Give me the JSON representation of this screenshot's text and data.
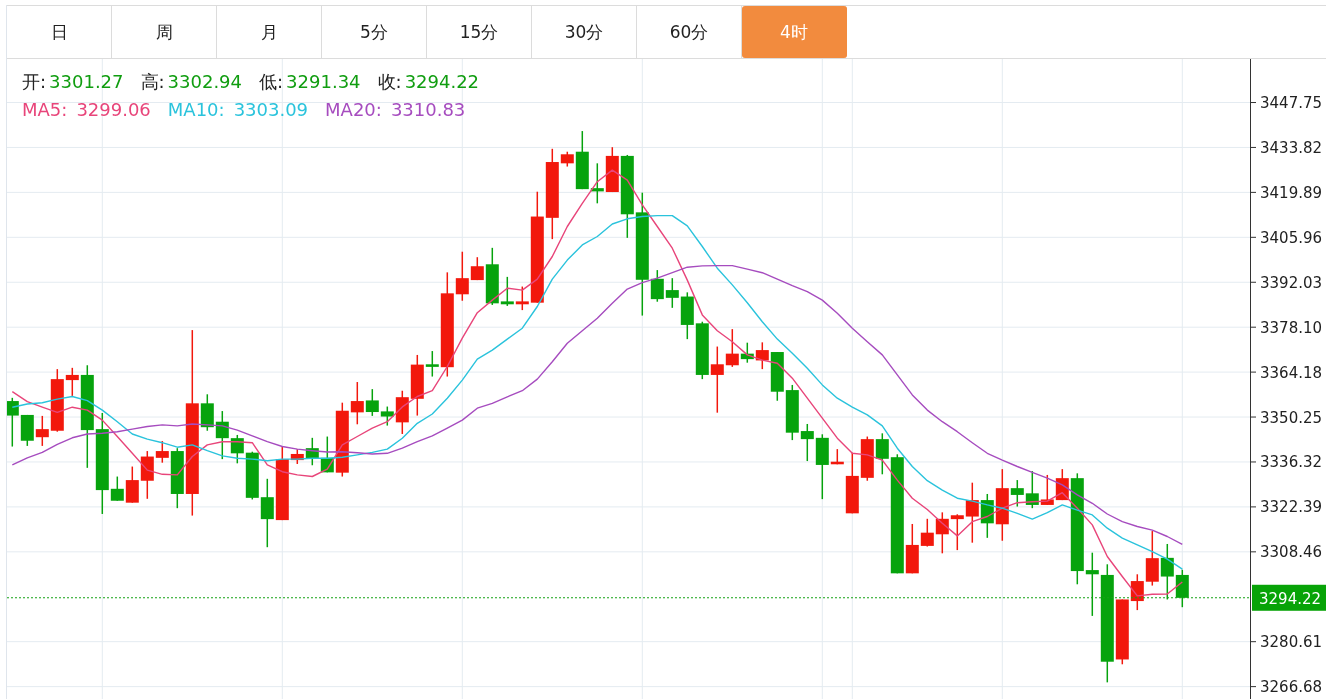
{
  "timeframe_tabs": [
    {
      "label": "日",
      "selected": false
    },
    {
      "label": "周",
      "selected": false
    },
    {
      "label": "月",
      "selected": false
    },
    {
      "label": "5分",
      "selected": false
    },
    {
      "label": "15分",
      "selected": false
    },
    {
      "label": "30分",
      "selected": false
    },
    {
      "label": "60分",
      "selected": false
    },
    {
      "label": "4时",
      "selected": true
    }
  ],
  "quote": {
    "prices": [
      {
        "label": "开:",
        "value": "3301.27"
      },
      {
        "label": "高:",
        "value": "3302.94"
      },
      {
        "label": "低:",
        "value": "3291.34"
      },
      {
        "label": "收:",
        "value": "3294.22"
      }
    ],
    "averages": [
      {
        "label": "MA5:",
        "value": "3299.06",
        "color": "#e8457a"
      },
      {
        "label": "MA10:",
        "value": "3303.09",
        "color": "#2ac3dc"
      },
      {
        "label": "MA20:",
        "value": "3310.83",
        "color": "#a64cbf"
      }
    ]
  },
  "chart": {
    "chart_data": {
      "type": "candlestick",
      "grid": true,
      "ylim": [
        3262.84,
        3461.24
      ],
      "yticks": [
        3447.75,
        3433.82,
        3419.89,
        3405.96,
        3392.03,
        {
          "value": 3378.1,
          "label": "3378.10"
        },
        3364.18,
        3350.25,
        3336.32,
        3322.39,
        3308.46,
        3280.61,
        3266.68
      ],
      "ohlc": [
        [
          3355.2,
          3356.2,
          3341.1,
          3350.7
        ],
        [
          3350.9,
          3350.9,
          3341.3,
          3342.9
        ],
        [
          3344.0,
          3350.6,
          3341.3,
          3346.5
        ],
        [
          3346.0,
          3365.1,
          3345.7,
          3362.0
        ],
        [
          3361.7,
          3365.5,
          3356.8,
          3363.3
        ],
        [
          3363.3,
          3366.3,
          3334.5,
          3346.2
        ],
        [
          3346.5,
          3351.5,
          3320.2,
          3327.6
        ],
        [
          3328.0,
          3331.8,
          3324.3,
          3324.3
        ],
        [
          3323.7,
          3334.9,
          3323.7,
          3330.7
        ],
        [
          3330.5,
          3339.7,
          3324.9,
          3338.0
        ],
        [
          3337.6,
          3342.8,
          3336.1,
          3339.7
        ],
        [
          3339.7,
          3340.6,
          3322.0,
          3326.4
        ],
        [
          3326.4,
          3377.2,
          3319.7,
          3354.5
        ],
        [
          3354.5,
          3357.3,
          3346.0,
          3347.1
        ],
        [
          3348.8,
          3352.1,
          3337.2,
          3343.7
        ],
        [
          3343.7,
          3344.7,
          3335.9,
          3339.0
        ],
        [
          3339.2,
          3339.5,
          3324.7,
          3325.2
        ],
        [
          3325.4,
          3331.1,
          3309.9,
          3318.6
        ],
        [
          3318.3,
          3341.1,
          3318.3,
          3337.2
        ],
        [
          3336.9,
          3340.3,
          3335.7,
          3338.8
        ],
        [
          3340.6,
          3343.8,
          3335.3,
          3337.5
        ],
        [
          3337.6,
          3344.2,
          3333.1,
          3333.1
        ],
        [
          3333.0,
          3354.7,
          3331.8,
          3352.2
        ],
        [
          3351.7,
          3361.1,
          3348.0,
          3355.2
        ],
        [
          3355.4,
          3358.9,
          3350.6,
          3351.8
        ],
        [
          3352.0,
          3353.5,
          3347.6,
          3350.4
        ],
        [
          3348.6,
          3358.4,
          3345.0,
          3356.4
        ],
        [
          3355.9,
          3369.5,
          3350.7,
          3366.5
        ],
        [
          3366.6,
          3370.7,
          3362.8,
          3365.8
        ],
        [
          3365.7,
          3395.1,
          3362.8,
          3388.6
        ],
        [
          3388.3,
          3401.5,
          3386.3,
          3393.3
        ],
        [
          3392.7,
          3399.8,
          3392.7,
          3397.0
        ],
        [
          3397.6,
          3402.7,
          3385.0,
          3385.5
        ],
        [
          3386.1,
          3393.7,
          3384.7,
          3385.2
        ],
        [
          3385.2,
          3390.7,
          3383.4,
          3386.1
        ],
        [
          3385.7,
          3420.1,
          3385.7,
          3412.4
        ],
        [
          3412.0,
          3433.4,
          3405.4,
          3429.3
        ],
        [
          3428.9,
          3432.5,
          3427.9,
          3431.7
        ],
        [
          3432.5,
          3438.9,
          3420.9,
          3420.9
        ],
        [
          3421.2,
          3428.9,
          3416.5,
          3420.2
        ],
        [
          3420.0,
          3433.9,
          3420.0,
          3431.2
        ],
        [
          3431.2,
          3431.5,
          3405.8,
          3413.1
        ],
        [
          3413.7,
          3419.8,
          3381.7,
          3392.8
        ],
        [
          3393.1,
          3395.8,
          3386.0,
          3386.8
        ],
        [
          3389.6,
          3393.3,
          3384.1,
          3387.2
        ],
        [
          3387.6,
          3388.9,
          3374.4,
          3378.8
        ],
        [
          3379.3,
          3379.8,
          3362.0,
          3363.3
        ],
        [
          3363.3,
          3372.1,
          3351.6,
          3366.6
        ],
        [
          3366.3,
          3377.5,
          3365.8,
          3369.9
        ],
        [
          3369.9,
          3373.3,
          3367.1,
          3368.2
        ],
        [
          3367.8,
          3373.4,
          3365.1,
          3371.0
        ],
        [
          3370.4,
          3370.4,
          3355.3,
          3358.1
        ],
        [
          3358.6,
          3360.2,
          3343.1,
          3345.4
        ],
        [
          3345.9,
          3348.1,
          3336.6,
          3343.4
        ],
        [
          3343.8,
          3344.9,
          3324.8,
          3335.4
        ],
        [
          3335.6,
          3340.3,
          3335.6,
          3336.4
        ],
        [
          3320.4,
          3339.2,
          3320.4,
          3332.0
        ],
        [
          3331.4,
          3344.2,
          3330.5,
          3343.4
        ],
        [
          3343.4,
          3345.2,
          3332.5,
          3337.3
        ],
        [
          3337.8,
          3338.7,
          3301.8,
          3301.8
        ],
        [
          3301.8,
          3317.1,
          3301.8,
          3310.6
        ],
        [
          3310.3,
          3318.7,
          3310.1,
          3314.4
        ],
        [
          3313.9,
          3320.7,
          3308.0,
          3318.7
        ],
        [
          3318.6,
          3320.1,
          3309.0,
          3319.8
        ],
        [
          3319.4,
          3329.9,
          3311.3,
          3324.5
        ],
        [
          3324.5,
          3326.4,
          3312.8,
          3317.3
        ],
        [
          3317.0,
          3334.1,
          3311.9,
          3328.2
        ],
        [
          3328.2,
          3330.7,
          3322.5,
          3326.1
        ],
        [
          3326.6,
          3333.5,
          3322.0,
          3323.0
        ],
        [
          3323.0,
          3332.3,
          3323.0,
          3324.7
        ],
        [
          3324.5,
          3334.1,
          3324.5,
          3331.3
        ],
        [
          3331.3,
          3332.8,
          3298.4,
          3302.5
        ],
        [
          3302.8,
          3308.2,
          3288.6,
          3301.5
        ],
        [
          3301.3,
          3304.6,
          3268.0,
          3274.4
        ],
        [
          3275.1,
          3293.7,
          3273.6,
          3293.7
        ],
        [
          3293.2,
          3301.5,
          3290.4,
          3299.4
        ],
        [
          3299.2,
          3314.9,
          3298.0,
          3306.5
        ],
        [
          3306.6,
          3310.9,
          3293.7,
          3300.8
        ],
        [
          3301.3,
          3302.9,
          3291.3,
          3294.2
        ]
      ],
      "series": [
        {
          "type": "line",
          "color": "#e8457a",
          "values": [
            3358.1,
            3355.0,
            3353.3,
            3351.7,
            3353.3,
            3352.4,
            3349.3,
            3344.2,
            3339.0,
            3333.8,
            3332.5,
            3332.3,
            3338.0,
            3341.6,
            3342.6,
            3342.6,
            3342.3,
            3335.4,
            3333.3,
            3332.3,
            3331.8,
            3334.1,
            3341.6,
            3344.2,
            3346.8,
            3348.8,
            3353.4,
            3356.6,
            3358.4,
            3365.9,
            3374.7,
            3382.6,
            3386.5,
            3390.2,
            3389.6,
            3393.0,
            3400.0,
            3409.3,
            3416.5,
            3423.2,
            3426.8,
            3423.7,
            3416.0,
            3409.3,
            3402.6,
            3392.7,
            3381.9,
            3377.0,
            3373.6,
            3369.5,
            3367.9,
            3366.9,
            3362.3,
            3356.1,
            3349.9,
            3343.7,
            3339.0,
            3338.5,
            3336.9,
            3330.7,
            3325.1,
            3321.6,
            3317.3,
            3313.4,
            3317.8,
            3319.4,
            3322.0,
            3323.7,
            3324.0,
            3324.2,
            3326.8,
            3322.0,
            3316.8,
            3307.0,
            3300.8,
            3294.8,
            3295.3,
            3295.4,
            3299.1
          ]
        },
        {
          "type": "line",
          "color": "#2ac3dc",
          "values": [
            3353.3,
            3354.3,
            3354.7,
            3355.8,
            3356.6,
            3355.3,
            3352.4,
            3348.8,
            3345.0,
            3343.4,
            3342.3,
            3340.9,
            3341.6,
            3339.8,
            3338.2,
            3337.5,
            3337.2,
            3336.7,
            3337.2,
            3337.2,
            3337.5,
            3337.5,
            3337.8,
            3338.5,
            3339.3,
            3340.3,
            3343.7,
            3348.3,
            3351.2,
            3356.1,
            3361.7,
            3368.2,
            3371.0,
            3374.4,
            3377.8,
            3384.5,
            3393.0,
            3398.9,
            3403.6,
            3406.2,
            3410.1,
            3411.7,
            3412.4,
            3412.7,
            3412.7,
            3409.5,
            3403.1,
            3396.4,
            3391.2,
            3385.7,
            3379.8,
            3374.4,
            3370.0,
            3365.4,
            3360.2,
            3356.1,
            3353.3,
            3350.9,
            3347.5,
            3340.6,
            3334.9,
            3330.5,
            3327.6,
            3325.1,
            3324.2,
            3323.0,
            3322.0,
            3320.4,
            3318.6,
            3320.6,
            3323.0,
            3321.4,
            3319.9,
            3315.8,
            3312.7,
            3310.6,
            3308.5,
            3306.2,
            3303.1
          ]
        },
        {
          "type": "line",
          "color": "#a64cbf",
          "values": [
            3335.4,
            3337.6,
            3339.3,
            3341.8,
            3343.8,
            3345.0,
            3345.2,
            3345.7,
            3346.5,
            3347.3,
            3347.8,
            3347.5,
            3348.1,
            3347.8,
            3347.5,
            3346.2,
            3344.4,
            3342.6,
            3341.1,
            3340.3,
            3339.8,
            3339.4,
            3339.5,
            3339.2,
            3338.8,
            3339.0,
            3340.6,
            3342.6,
            3344.4,
            3346.8,
            3349.3,
            3353.0,
            3354.5,
            3356.5,
            3358.4,
            3362.0,
            3367.4,
            3373.1,
            3377.0,
            3380.9,
            3385.5,
            3389.9,
            3391.9,
            3393.3,
            3395.0,
            3396.7,
            3397.1,
            3397.2,
            3397.2,
            3396.1,
            3395.0,
            3393.0,
            3391.0,
            3389.1,
            3386.5,
            3382.4,
            3377.8,
            3373.6,
            3369.5,
            3363.3,
            3357.1,
            3352.4,
            3348.8,
            3345.7,
            3342.3,
            3339.0,
            3336.9,
            3334.9,
            3333.1,
            3331.3,
            3329.2,
            3326.1,
            3323.5,
            3320.2,
            3317.8,
            3316.3,
            3315.2,
            3313.2,
            3310.8
          ]
        }
      ],
      "ref_lines": [
        {
          "axis": "y",
          "value": 3294.22,
          "label": "3294.22"
        }
      ]
    }
  }
}
